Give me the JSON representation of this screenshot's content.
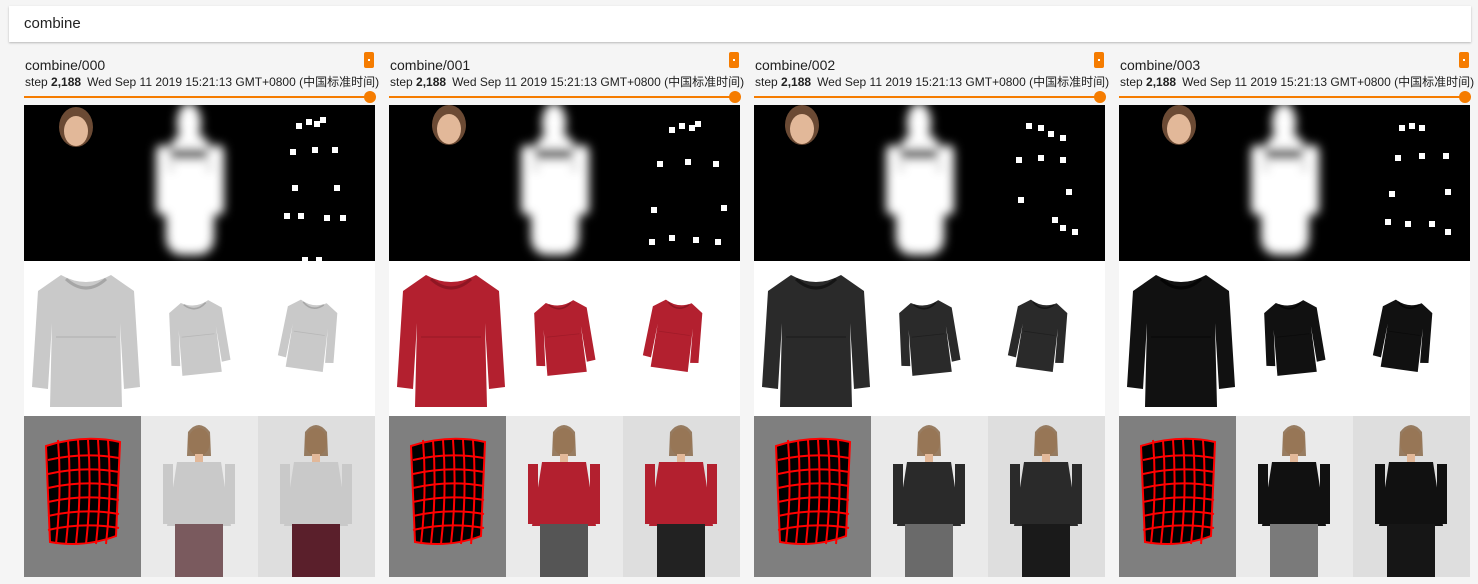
{
  "search": {
    "query": "combine"
  },
  "cards": [
    {
      "name": "combine/000",
      "step_label": "step",
      "step_value": "2,188",
      "timestamp": "Wed Sep 11 2019 15:21:13 GMT+0800 (中国标准时间)",
      "garment_color": "#c9c9c9",
      "garment_shade": "#a6a6a6",
      "bottom_color": "#7a5a5e",
      "bottom_color_2": "#5a1f2b",
      "slider_progress": 1.0
    },
    {
      "name": "combine/001",
      "step_label": "step",
      "step_value": "2,188",
      "timestamp": "Wed Sep 11 2019 15:21:13 GMT+0800 (中国标准时间)",
      "garment_color": "#b3202f",
      "garment_shade": "#8f1623",
      "bottom_color": "#555555",
      "bottom_color_2": "#222222",
      "slider_progress": 1.0
    },
    {
      "name": "combine/002",
      "step_label": "step",
      "step_value": "2,188",
      "timestamp": "Wed Sep 11 2019 15:21:13 GMT+0800 (中国标准时间)",
      "garment_color": "#2a2a2a",
      "garment_shade": "#151515",
      "bottom_color": "#6a6a6a",
      "bottom_color_2": "#1a1a1a",
      "slider_progress": 1.0
    },
    {
      "name": "combine/003",
      "step_label": "step",
      "step_value": "2,188",
      "timestamp": "Wed Sep 11 2019 15:21:13 GMT+0800 (中国标准时间)",
      "garment_color": "#111111",
      "garment_shade": "#050505",
      "bottom_color": "#7a7a7a",
      "bottom_color_2": "#161616",
      "slider_progress": 1.0
    }
  ],
  "colors": {
    "accent": "#f57c00",
    "grid_red": "#ff0000"
  },
  "icons": {
    "menu": "more-vert-icon"
  }
}
